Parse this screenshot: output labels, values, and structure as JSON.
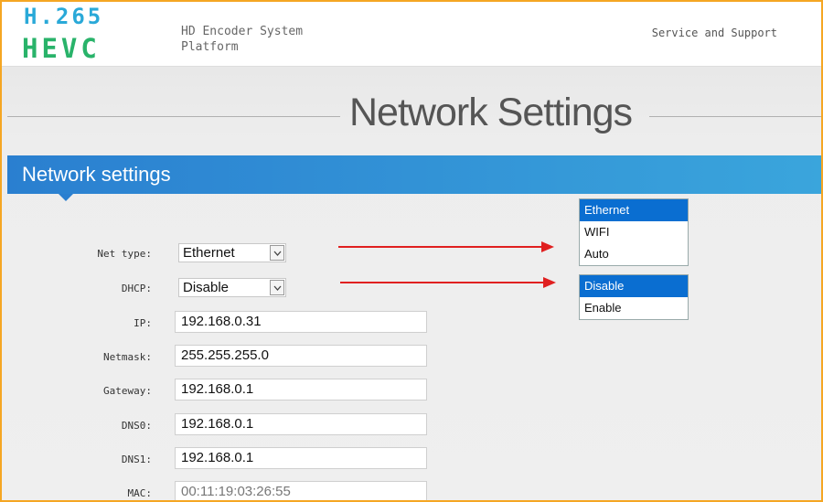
{
  "header": {
    "logo_line1": "H.265",
    "logo_line2": "HEVC",
    "platform": "HD Encoder System Platform",
    "support_link": "Service and Support"
  },
  "page_title": "Network Settings",
  "section_title": "Network settings",
  "form": {
    "net_type": {
      "label": "Net type:",
      "value": "Ethernet"
    },
    "dhcp": {
      "label": "DHCP:",
      "value": "Disable"
    },
    "ip": {
      "label": "IP:",
      "value": "192.168.0.31"
    },
    "netmask": {
      "label": "Netmask:",
      "value": "255.255.255.0"
    },
    "gateway": {
      "label": "Gateway:",
      "value": "192.168.0.1"
    },
    "dns0": {
      "label": "DNS0:",
      "value": "192.168.0.1"
    },
    "dns1": {
      "label": "DNS1:",
      "value": "192.168.0.1"
    },
    "mac": {
      "label": "MAC:",
      "value": "00:11:19:03:26:55"
    }
  },
  "net_type_options": [
    "Ethernet",
    "WIFI",
    "Auto"
  ],
  "dhcp_options": [
    "Disable",
    "Enable"
  ],
  "colors": {
    "accent": "#2a7fd0",
    "arrow": "#e02020",
    "selected_option": "#0a6ed1",
    "logo_blue": "#2aa9d8",
    "logo_green": "#29b36a",
    "frame": "#f5a623"
  },
  "icons": {
    "dropdown": "chevron-down-icon",
    "annotation": "red-arrow-icon"
  }
}
